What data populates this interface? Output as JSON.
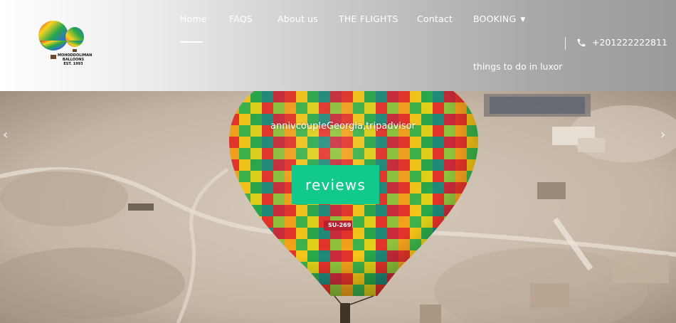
{
  "brand": {
    "logo_text_line1": "MOHODDOLIMAN",
    "logo_text_line2": "BALLOONS",
    "logo_text_line3": "EST. 1993"
  },
  "nav": {
    "items": [
      {
        "label": "Home"
      },
      {
        "label": "FAQS"
      },
      {
        "label": "About us"
      },
      {
        "label": "THE FLIGHTS"
      },
      {
        "label": "Contact"
      },
      {
        "label": "BOOKING"
      }
    ],
    "booking_chevron": "chevron-down-icon",
    "sub_item": "things to do in luxor"
  },
  "contact": {
    "phone": "+201222222811",
    "phone_icon": "phone-icon"
  },
  "hero": {
    "caption": "annivcoupleGeorgia,tripadvisor",
    "button_label": "reviews",
    "balloon_marking": "SU-269",
    "prev_arrow": "‹",
    "next_arrow": "›"
  },
  "colors": {
    "accent": "#10c98a",
    "header_light": "#ffffff",
    "header_dark": "#9a9a9a",
    "text_light": "#ffffff"
  }
}
